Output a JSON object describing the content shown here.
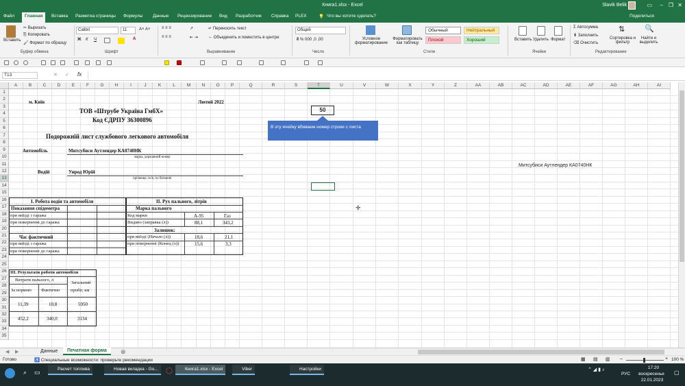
{
  "window": {
    "title": "Книга1.xlsx - Excel",
    "user": "Slavik Belik",
    "share": "Поделиться"
  },
  "tabs": [
    "Файл",
    "Главная",
    "Вставка",
    "Разметка страницы",
    "Формулы",
    "Данные",
    "Рецензирование",
    "Вид",
    "Разработчик",
    "Справка",
    "PLEX"
  ],
  "tell_me": "Что вы хотите сделать?",
  "ribbon": {
    "paste": "Вставить",
    "cut": "Вырезать",
    "copy": "Копировать",
    "format_painter": "Формат по образцу",
    "clipboard": "Буфер обмена",
    "font_name": "Calibri",
    "font_size": "11",
    "font_group": "Шрифт",
    "wrap": "Переносить текст",
    "merge": "Объединить и поместить в центре",
    "alignment": "Выравнивание",
    "number_format": "Общий",
    "number": "Число",
    "cond_format": "Условное форматирование",
    "format_table": "Форматировать как таблицу",
    "style_normal": "Обычный",
    "style_neutral": "Нейтральный",
    "style_bad": "Плохой",
    "style_good": "Хороший",
    "styles": "Стили",
    "insert": "Вставить",
    "delete": "Удалить",
    "format": "Формат",
    "cells": "Ячейки",
    "autosum": "Автосумма",
    "fill": "Заполнить",
    "clear": "Очистить",
    "sort": "Сортировка и фильтр",
    "find": "Найти и выделить",
    "editing": "Редактирование"
  },
  "name_box": "T13",
  "columns": [
    "A",
    "B",
    "C",
    "D",
    "E",
    "F",
    "G",
    "H",
    "I",
    "J",
    "K",
    "L",
    "M",
    "N",
    "O",
    "P",
    "Q",
    "R",
    "S",
    "T",
    "U",
    "V",
    "W",
    "X",
    "Y",
    "Z",
    "AA",
    "AB",
    "AC",
    "AD",
    "AE",
    "AF",
    "AG",
    "AH",
    "AI"
  ],
  "rows": [
    "1",
    "2",
    "3",
    "4",
    "5",
    "6",
    "7",
    "8",
    "9",
    "10",
    "11",
    "12",
    "13",
    "14",
    "15",
    "16",
    "17",
    "18",
    "19",
    "20",
    "21",
    "22",
    "23",
    "24",
    "25",
    "26",
    "27",
    "28",
    "29",
    "30",
    "31",
    "32",
    "33",
    "34",
    "35"
  ],
  "sheet": {
    "city": "м. Київ",
    "month": "Лютий 2022",
    "company": "ТОВ «Штрубе Україна ГмбХ»",
    "edrpou": "Код ЄДРПУ 36300896",
    "doc_title": "Подорожній лист службового легкового автомобіля",
    "car_label": "Автомобіль",
    "car_value": "Митсубиси Аутлендер КА0740НК",
    "car_hint": "марка, державний номер",
    "driver_label": "Водій",
    "driver_value": "Унрод Юрій",
    "driver_hint": "прізвище, ім'я, по батькові",
    "t1_title": "I. Робота водія та автомобіля",
    "t1_odometer": "Показання спідометра",
    "t1_out": "при виїзді з гаража",
    "t1_in": "при поверненні до гаража",
    "t1_time": "Час фактичний",
    "t1_out2": "при виїзді з гаража",
    "t1_in2": "при поверненні до гаража",
    "t2_title": "II. Рух пального, літрів",
    "t2_brand": "Марка пального",
    "t2_code": "Код марки",
    "t2_a95": "А-95",
    "t2_gas": "Газ",
    "t2_issued": "Видано (заправка (л))",
    "t2_issued_a95": "88,1",
    "t2_issued_gas": "343,2",
    "t2_rest": "Залишок:",
    "t2_start": "при виїзді (Начало (л))",
    "t2_start_a95": "18,6",
    "t2_start_gas": "21,1",
    "t2_end": "при поверненні (Конец (л))",
    "t2_end_a95": "15,6",
    "t2_end_gas": "3,3",
    "t3_title": "III. Результати роботи автомобіля",
    "t3_fuel": "Витрати пального, л",
    "t3_norm": "За нормою",
    "t3_fact": "Фактично",
    "t3_total_1": "Загальний",
    "t3_total_2": "пробіг, км",
    "t3_r1": [
      "11,39",
      "10,8",
      "5950"
    ],
    "t3_r2": [
      "452,2",
      "340,0",
      "3134"
    ],
    "t_value": "50",
    "note": "В эту ячейку вбиваем номер строки с листа",
    "ad_value": "Митсубиси Аутлендер КА0740НК"
  },
  "sheet_tabs": [
    "Данные",
    "Печатная форма"
  ],
  "status": {
    "ready": "Готово",
    "accessibility": "Специальные возможности: проверьте рекомендации",
    "zoom": "100 %"
  },
  "taskbar": {
    "items": [
      "Расчет топлива",
      "Новая вкладка - Go...",
      "Книга1.xlsx - Excel",
      "Viber",
      "Настройки"
    ],
    "lang": "РУС",
    "time": "17:20",
    "day": "воскресенье",
    "date": "22.01.2023"
  }
}
